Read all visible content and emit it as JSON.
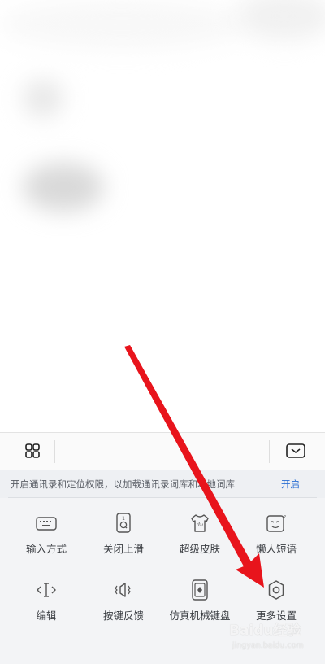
{
  "toolbar": {
    "left_icon": "grid-apps-icon",
    "right_icon": "collapse-keyboard-icon"
  },
  "notice": {
    "text": "开启通讯录和定位权限，以加载通讯录词库和本地词库",
    "action": "开启"
  },
  "grid": {
    "items": [
      {
        "label": "输入方式",
        "icon": "keyboard-icon"
      },
      {
        "label": "关闭上滑",
        "icon": "swipe-up-icon"
      },
      {
        "label": "超级皮肤",
        "icon": "skin-tshirt-icon"
      },
      {
        "label": "懒人短语",
        "icon": "quick-phrase-icon"
      },
      {
        "label": "编辑",
        "icon": "text-cursor-icon"
      },
      {
        "label": "按键反馈",
        "icon": "key-feedback-icon"
      },
      {
        "label": "仿真机械键盘",
        "icon": "mechanical-keyboard-icon"
      },
      {
        "label": "更多设置",
        "icon": "gear-icon"
      }
    ]
  },
  "watermark": {
    "main": "Baidu经验",
    "sub": "jingyan.baidu.com"
  },
  "colors": {
    "arrow": "#e8141c",
    "accent": "#2b6fd3"
  }
}
